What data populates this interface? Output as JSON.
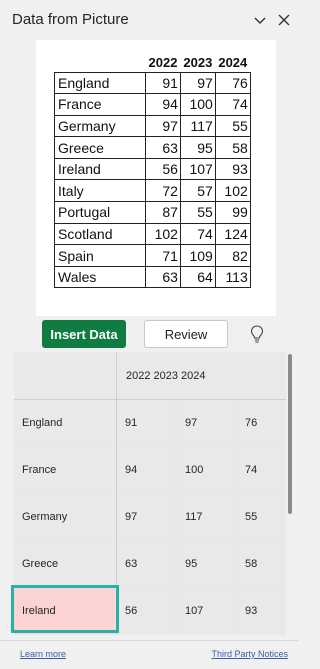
{
  "panel": {
    "title": "Data from Picture"
  },
  "picture": {
    "headers": [
      "",
      "2022",
      "2023",
      "2024"
    ],
    "rows": [
      {
        "country": "England",
        "values": [
          "91",
          "97",
          "76"
        ]
      },
      {
        "country": "France",
        "values": [
          "94",
          "100",
          "74"
        ]
      },
      {
        "country": "Germany",
        "values": [
          "97",
          "117",
          "55"
        ]
      },
      {
        "country": "Greece",
        "values": [
          "63",
          "95",
          "58"
        ]
      },
      {
        "country": "Ireland",
        "values": [
          "56",
          "107",
          "93"
        ]
      },
      {
        "country": "Italy",
        "values": [
          "72",
          "57",
          "102"
        ]
      },
      {
        "country": "Portugal",
        "values": [
          "87",
          "55",
          "99"
        ]
      },
      {
        "country": "Scotland",
        "values": [
          "102",
          "74",
          "124"
        ]
      },
      {
        "country": "Spain",
        "values": [
          "71",
          "109",
          "82"
        ]
      },
      {
        "country": "Wales",
        "values": [
          "63",
          "64",
          "113"
        ]
      }
    ]
  },
  "actions": {
    "insert_label": "Insert Data",
    "review_label": "Review"
  },
  "grid": {
    "header_text": "2022 2023 2024",
    "rows": [
      {
        "country": "England",
        "values": [
          "91",
          "97",
          "76"
        ]
      },
      {
        "country": "France",
        "values": [
          "94",
          "100",
          "74"
        ]
      },
      {
        "country": "Germany",
        "values": [
          "97",
          "117",
          "55"
        ]
      },
      {
        "country": "Greece",
        "values": [
          "63",
          "95",
          "58"
        ]
      },
      {
        "country": "Ireland",
        "values": [
          "56",
          "107",
          "93"
        ]
      }
    ],
    "selected_row": "Ireland"
  },
  "footer": {
    "learn_more": "Learn more",
    "third_party": "Third Party Notices"
  },
  "colors": {
    "accent": "#107c41",
    "selection_border": "#2ab1a6",
    "selection_fill": "#fbd3d3",
    "link": "#3a5da8"
  },
  "icons": {
    "collapse": "chevron-down-icon",
    "close": "close-icon",
    "suggestion": "lightbulb-icon"
  }
}
